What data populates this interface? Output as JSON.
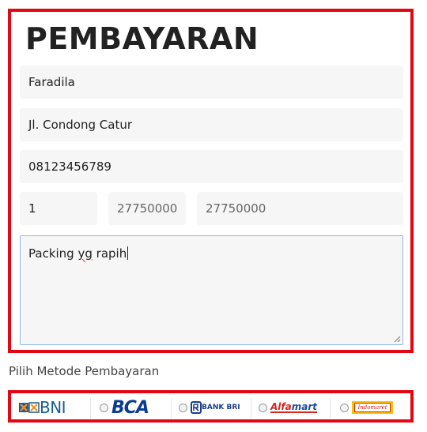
{
  "form": {
    "title": "PEMBAYARAN",
    "name_value": "Faradila",
    "address_value": "Jl. Condong Catur",
    "phone_value": "08123456789",
    "quantity_value": "1",
    "price_value": "27750000",
    "total_value": "27750000",
    "notes_value": "Packing",
    "notes_misspelled": "yg",
    "notes_tail": "rapih"
  },
  "payment": {
    "label": "Pilih Metode Pembayaran",
    "methods": [
      {
        "name": "BNI",
        "color": "#1d5c8c",
        "icon": "bni-logo"
      },
      {
        "name": "BCA",
        "color": "#0a3d8f",
        "icon": "bca-logo"
      },
      {
        "name": "BANK BRI",
        "color": "#1a3e8c",
        "icon": "bri-logo"
      },
      {
        "name": "Alfa",
        "name_suffix": "mart",
        "color": "#d9261c",
        "icon": "alfamart-logo"
      },
      {
        "name": "Indomaret",
        "color": "#f5c400",
        "icon": "indomaret-logo"
      }
    ]
  },
  "colors": {
    "highlight_border": "#e30613",
    "field_bg": "#f6f6f6",
    "focus_border": "#8fb6e6"
  }
}
